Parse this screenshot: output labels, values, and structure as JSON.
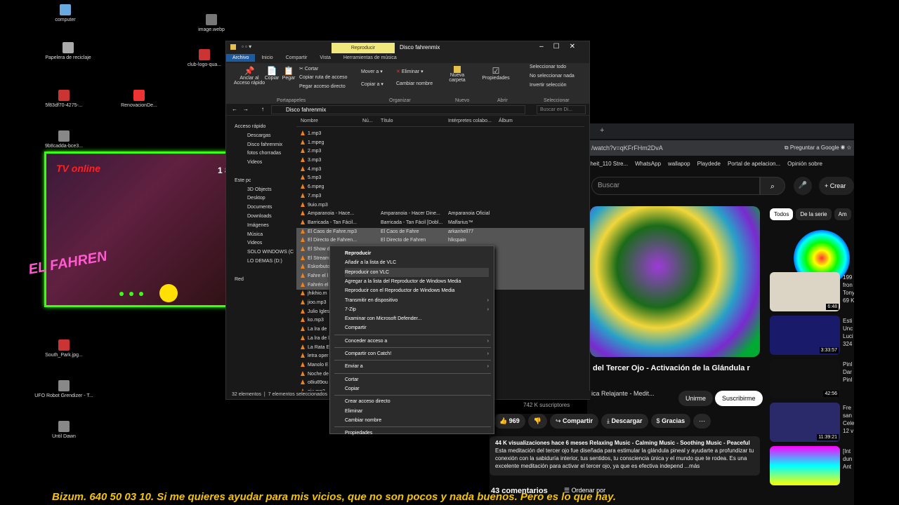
{
  "desktop": {
    "icons": [
      {
        "label": "computer",
        "color": "#6aa8e0"
      },
      {
        "label": "image.webp",
        "color": "#777"
      },
      {
        "label": "Papelera de reciclaje",
        "color": "#aaa"
      },
      {
        "label": "club-logo-qua...",
        "color": "#c33"
      },
      {
        "label": "5f83df70-4275-...",
        "color": "#c33"
      },
      {
        "label": "RenovacionDe...",
        "color": "#e33"
      },
      {
        "label": "9b8cadda-bce3...",
        "color": "#888"
      },
      {
        "label": "Disco fahrenmix",
        "color": "#e6c04a"
      },
      {
        "label": "South_Park.jpg...",
        "color": "#c33"
      },
      {
        "label": "UFO Robot Grendizer - T...",
        "color": "#888"
      },
      {
        "label": "Until Dawn",
        "color": "#888"
      }
    ]
  },
  "webcam": {
    "banner": "TV online",
    "counter": "1 8",
    "logo": "EL FAHREN"
  },
  "ticker": "Bizum. 640 50 03 10.  Si me quieres ayudar para mis vicios, que no son pocos y nada buenos. Pero es lo que hay.",
  "explorer": {
    "context_tab": "Reproducir",
    "title": "Disco fahrenmix",
    "ribbon_tabs": [
      "Archivo",
      "Inicio",
      "Compartir",
      "Vista",
      "Herramientas de música"
    ],
    "ribbon": {
      "pin": "Anclar al Acceso rápido",
      "copy": "Copiar",
      "paste": "Pegar",
      "cut": "Cortar",
      "copy_path": "Copiar ruta de acceso",
      "paste_shortcut": "Pegar acceso directo",
      "move": "Mover a",
      "copy_to": "Copiar a",
      "delete": "Eliminar",
      "rename": "Cambiar nombre",
      "new_folder": "Nueva carpeta",
      "properties": "Propiedades",
      "select_all": "Seleccionar todo",
      "select_none": "No seleccionar nada",
      "invert": "Invertir selección",
      "groups": [
        "Portapapeles",
        "Organizar",
        "Nuevo",
        "Abrir",
        "Seleccionar"
      ]
    },
    "address": "Disco fahrenmix",
    "search_placeholder": "Buscar en Di...",
    "nav": [
      "Acceso rápido",
      "Descargas",
      "Disco fahrenmix",
      "fotos chorradas",
      "Videos",
      "",
      "Este pc",
      "3D Objects",
      "Desktop",
      "Documents",
      "Downloads",
      "Imágenes",
      "Música",
      "Videos",
      "SOLO WINDOWS (C",
      "LO DEMAS (D:)",
      "",
      "Red"
    ],
    "columns": [
      "Nombre",
      "Nú...",
      "Título",
      "Intérpretes colabo...",
      "Álbum"
    ],
    "files": [
      {
        "name": "1.mp3",
        "title": "",
        "artist": "",
        "sel": false
      },
      {
        "name": "1.mpeg",
        "title": "",
        "artist": "",
        "sel": false
      },
      {
        "name": "2.mp3",
        "title": "",
        "artist": "",
        "sel": false
      },
      {
        "name": "3.mp3",
        "title": "",
        "artist": "",
        "sel": false
      },
      {
        "name": "4.mp3",
        "title": "",
        "artist": "",
        "sel": false
      },
      {
        "name": "5.mp3",
        "title": "",
        "artist": "",
        "sel": false
      },
      {
        "name": "6.mpeg",
        "title": "",
        "artist": "",
        "sel": false
      },
      {
        "name": "7.mp3",
        "title": "",
        "artist": "",
        "sel": false
      },
      {
        "name": "9uio.mp3",
        "title": "",
        "artist": "",
        "sel": false
      },
      {
        "name": "Amparanoia - Hace...",
        "title": "Amparanoia - Hacer Dine...",
        "artist": "Amparanoia Oficial",
        "sel": false
      },
      {
        "name": "Barricada - Tan Fácil...",
        "title": "Barricada - Tan Fácil [Dobl...",
        "artist": "Malfarius™",
        "sel": false
      },
      {
        "name": "El Caos de Fahre.mp3",
        "title": "El Caos de Fahre",
        "artist": "arkanhell77",
        "sel": true
      },
      {
        "name": "El Directo de Fahren...",
        "title": "El Directo de Fahren",
        "artist": "hlkspain",
        "sel": true
      },
      {
        "name": "El Show d",
        "title": "",
        "artist": "",
        "sel": true
      },
      {
        "name": "El Stream",
        "title": "",
        "artist": "",
        "sel": true
      },
      {
        "name": "Eskorbuto",
        "title": "",
        "artist": "",
        "sel": true
      },
      {
        "name": "Fahre el l",
        "title": "",
        "artist": "",
        "sel": true
      },
      {
        "name": "Fahrén el",
        "title": "",
        "artist": "",
        "sel": true
      },
      {
        "name": "jhikhio.m",
        "title": "",
        "artist": "",
        "sel": false
      },
      {
        "name": "jioo.mp3",
        "title": "",
        "artist": "",
        "sel": false
      },
      {
        "name": "Julio Igles",
        "title": "",
        "artist": "",
        "sel": false
      },
      {
        "name": "ko.mp3",
        "title": "",
        "artist": "",
        "sel": false
      },
      {
        "name": "La lra de",
        "title": "",
        "artist": "",
        "sel": false
      },
      {
        "name": "La lra de l",
        "title": "",
        "artist": "",
        "sel": false
      },
      {
        "name": "La Rata E",
        "title": "",
        "artist": "",
        "sel": false
      },
      {
        "name": "letra oper",
        "title": "",
        "artist": "",
        "sel": false
      },
      {
        "name": "Manolo E",
        "title": "",
        "artist": "",
        "sel": false
      },
      {
        "name": "Noche de",
        "title": "",
        "artist": "",
        "sel": false
      },
      {
        "name": "o8iu89ou",
        "title": "",
        "artist": "",
        "sel": false
      },
      {
        "name": "oiu.mp3",
        "title": "",
        "artist": "",
        "sel": false
      }
    ],
    "status": [
      "32 elementos",
      "7 elementos seleccionados"
    ]
  },
  "context_menu": [
    {
      "label": "Reproducir",
      "bold": true,
      "sub": false
    },
    {
      "label": "Añadir a la lista de VLC",
      "bold": false,
      "sub": false
    },
    {
      "label": "Reproducir con VLC",
      "bold": false,
      "sub": false,
      "hl": true
    },
    {
      "label": "Agregar a la lista del Reproductor de Windows Media",
      "bold": false,
      "sub": false
    },
    {
      "label": "Reproducir con el Reproductor de Windows Media",
      "bold": false,
      "sub": false
    },
    {
      "label": "Transmitir en dispositivo",
      "bold": false,
      "sub": true
    },
    {
      "label": "7-Zip",
      "bold": false,
      "sub": true
    },
    {
      "label": "Examinar con Microsoft Defender...",
      "bold": false,
      "sub": false
    },
    {
      "label": "Compartir",
      "bold": false,
      "sub": false
    },
    {
      "sep": true
    },
    {
      "label": "Conceder acceso a",
      "bold": false,
      "sub": true
    },
    {
      "sep": true
    },
    {
      "label": "Compartir con Catch!",
      "bold": false,
      "sub": true
    },
    {
      "sep": true
    },
    {
      "label": "Enviar a",
      "bold": false,
      "sub": true
    },
    {
      "sep": true
    },
    {
      "label": "Cortar",
      "bold": false,
      "sub": false
    },
    {
      "label": "Copiar",
      "bold": false,
      "sub": false
    },
    {
      "sep": true
    },
    {
      "label": "Crear acceso directo",
      "bold": false,
      "sub": false
    },
    {
      "label": "Eliminar",
      "bold": false,
      "sub": false
    },
    {
      "label": "Cambiar nombre",
      "bold": false,
      "sub": false
    },
    {
      "sep": true
    },
    {
      "label": "Propiedades",
      "bold": false,
      "sub": false
    }
  ],
  "browser": {
    "url": "/watch?v=qKFrFHm2DvA",
    "ask_google": "Preguntar a Google",
    "bookmarks": [
      "nheit_110 Stre...",
      "WhatsApp",
      "wallapop",
      "Playdede",
      "Portal de apelacion...",
      "Opinión sobre"
    ],
    "search_placeholder": "Buscar",
    "create": "Crear",
    "chips": [
      "Todos",
      "De la serie",
      "Am"
    ],
    "video_title": "del Tercer Ojo - Activación de la Glándula r",
    "channel": "ica Relajante - Medit...",
    "subscribers": "742 K suscriptores",
    "join": "Unirme",
    "subscribe": "Suscribirme",
    "likes": "969",
    "share": "Compartir",
    "download": "Descargar",
    "thanks": "Gracias",
    "views_line": "44 K visualizaciones  hace 6 meses  Relaxing Music - Calming Music - Soothing Music - Peaceful",
    "description": "Esta meditación del tercer ojo fue diseñada para estimular la glándula pineal y ayudarte a profundizar tu conexión con la sabiduría interior, tus sentidos, tu consciencia única y el mundo que te rodea. Es una excelente meditación para activar el tercer ojo, ya que es efectiva independ ...más",
    "comments": "43 comentarios",
    "sort": "Ordenar por",
    "side": [
      {
        "duration": "",
        "meta": [
          "",
          "",
          ""
        ]
      },
      {
        "duration": "6:48",
        "meta": [
          "199",
          "fron",
          "Tony 69 K"
        ]
      },
      {
        "duration": "3:33:57",
        "meta": [
          "Esti",
          "Unc",
          "Luci 324"
        ]
      },
      {
        "duration": "42:56",
        "meta": [
          "Pinl",
          "Dar",
          "Pinl"
        ]
      },
      {
        "duration": "11:39:21",
        "meta": [
          "Fre",
          "san",
          "Cele 12 v"
        ]
      },
      {
        "duration": "",
        "meta": [
          "[Int",
          "dun",
          "Ant"
        ]
      }
    ]
  }
}
